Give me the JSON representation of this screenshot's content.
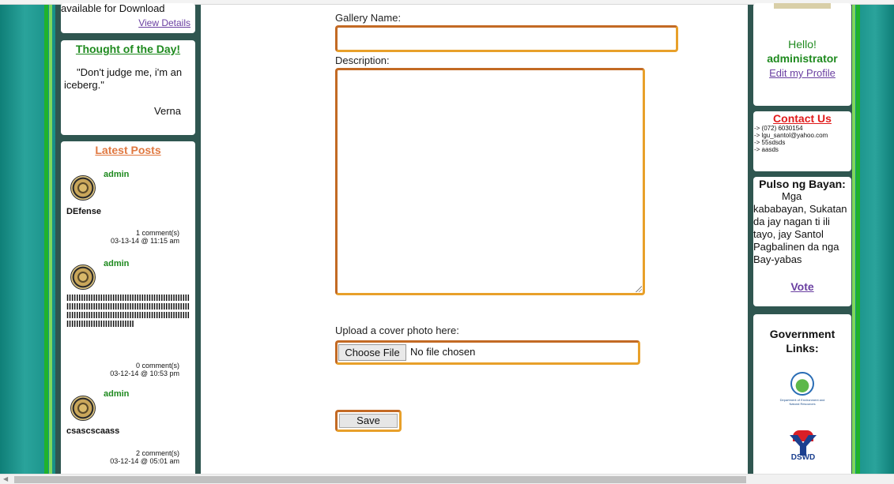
{
  "left_sidebar": {
    "download_panel": {
      "text": "available for Download",
      "view_details": "View Details"
    },
    "thought": {
      "title": "Thought of the Day!",
      "quote": "\"Don't judge me, i'm an iceberg.\"",
      "author": "Verna"
    },
    "latest_posts": {
      "title": "Latest Posts",
      "posts": [
        {
          "author": "admin",
          "title": "DEfense",
          "comments": "1 comment(s)",
          "date": "03-13-14 @ 11:15 am"
        },
        {
          "author": "admin",
          "title": "lllllllllllllllllllllllllllllllllllllllllllllllllllllllllllllllllllllllllllllllllllllllllllllllllllllllllllllllllllllllllllllllllllllllllllllllllllllllllllllllllllllllllllllllllllll",
          "comments": "0 comment(s)",
          "date": "03-12-14 @ 10:53 pm"
        },
        {
          "author": "admin",
          "title": "csascscaass",
          "comments": "2 comment(s)",
          "date": "03-12-14 @ 05:01 am"
        }
      ]
    }
  },
  "form": {
    "gallery_name_label": "Gallery Name:",
    "gallery_name_value": "",
    "description_label": "Description:",
    "description_value": "",
    "upload_label": "Upload a cover photo here:",
    "choose_file": "Choose File",
    "no_file": "No file chosen",
    "save": "Save"
  },
  "right_sidebar": {
    "hello": "Hello!",
    "username": "administrator",
    "edit_profile": "Edit my Profile",
    "contact": {
      "title": "Contact Us",
      "lines": [
        "-> (072) 6030154",
        "-> lgu_santol@yahoo.com",
        "-> 55sdsds",
        "-> aasds"
      ]
    },
    "pulso": {
      "title": "Pulso ng Bayan:",
      "body": "Mga kababayan, Sukatan da jay nagan ti ili tayo, jay Santol Pagbalinen da nga Bay-yabas",
      "vote": "Vote"
    },
    "government": {
      "title": "Government Links:",
      "denr_caption": "Department of Environment and Natural Resources",
      "dswd_text": "DSWD"
    }
  },
  "colors": {
    "green_text": "#1e8a1e",
    "orange_title": "#e07840",
    "link_purple": "#6a3fa1",
    "contact_red": "#e01b1b",
    "field_border_orange": "#e8a02a",
    "sidebar_dark": "#2f5650",
    "teal_band": "#2aa39b"
  }
}
